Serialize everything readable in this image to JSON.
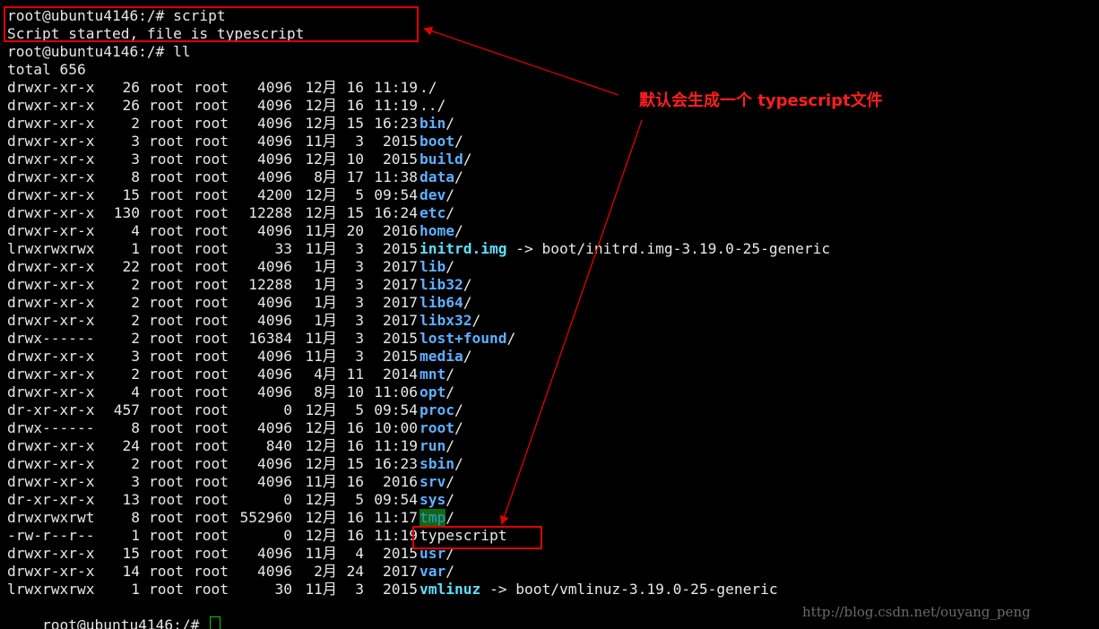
{
  "terminal": {
    "prompt_script": "root@ubuntu4146:/# script",
    "script_started": "Script started, file is typescript",
    "prompt_ll": "root@ubuntu4146:/# ll",
    "total": "total 656",
    "prompt_final": "root@ubuntu4146:/# ",
    "entries": [
      {
        "perm": "drwxr-xr-x",
        "links": "26",
        "owner": "root",
        "group": "root",
        "size": "4096",
        "month": "12月",
        "day": "16",
        "time": "11:19",
        "name": "./",
        "kind": "plain",
        "suffix": "",
        "target": ""
      },
      {
        "perm": "drwxr-xr-x",
        "links": "26",
        "owner": "root",
        "group": "root",
        "size": "4096",
        "month": "12月",
        "day": "16",
        "time": "11:19",
        "name": "../",
        "kind": "plain",
        "suffix": "",
        "target": ""
      },
      {
        "perm": "drwxr-xr-x",
        "links": "2",
        "owner": "root",
        "group": "root",
        "size": "4096",
        "month": "12月",
        "day": "15",
        "time": "16:23",
        "name": "bin",
        "kind": "dir",
        "suffix": "/",
        "target": ""
      },
      {
        "perm": "drwxr-xr-x",
        "links": "3",
        "owner": "root",
        "group": "root",
        "size": "4096",
        "month": "11月",
        "day": "3",
        "time": "2015",
        "name": "boot",
        "kind": "dir",
        "suffix": "/",
        "target": ""
      },
      {
        "perm": "drwxr-xr-x",
        "links": "3",
        "owner": "root",
        "group": "root",
        "size": "4096",
        "month": "12月",
        "day": "10",
        "time": "2015",
        "name": "build",
        "kind": "dir",
        "suffix": "/",
        "target": ""
      },
      {
        "perm": "drwxr-xr-x",
        "links": "8",
        "owner": "root",
        "group": "root",
        "size": "4096",
        "month": "8月",
        "day": "17",
        "time": "11:38",
        "name": "data",
        "kind": "dir",
        "suffix": "/",
        "target": ""
      },
      {
        "perm": "drwxr-xr-x",
        "links": "15",
        "owner": "root",
        "group": "root",
        "size": "4200",
        "month": "12月",
        "day": "5",
        "time": "09:54",
        "name": "dev",
        "kind": "dir",
        "suffix": "/",
        "target": ""
      },
      {
        "perm": "drwxr-xr-x",
        "links": "130",
        "owner": "root",
        "group": "root",
        "size": "12288",
        "month": "12月",
        "day": "15",
        "time": "16:24",
        "name": "etc",
        "kind": "dir",
        "suffix": "/",
        "target": ""
      },
      {
        "perm": "drwxr-xr-x",
        "links": "4",
        "owner": "root",
        "group": "root",
        "size": "4096",
        "month": "11月",
        "day": "20",
        "time": "2016",
        "name": "home",
        "kind": "dir",
        "suffix": "/",
        "target": ""
      },
      {
        "perm": "lrwxrwxrwx",
        "links": "1",
        "owner": "root",
        "group": "root",
        "size": "33",
        "month": "11月",
        "day": "3",
        "time": "2015",
        "name": "initrd.img",
        "kind": "link",
        "suffix": "",
        "target": " -> boot/initrd.img-3.19.0-25-generic"
      },
      {
        "perm": "drwxr-xr-x",
        "links": "22",
        "owner": "root",
        "group": "root",
        "size": "4096",
        "month": "1月",
        "day": "3",
        "time": "2017",
        "name": "lib",
        "kind": "dir",
        "suffix": "/",
        "target": ""
      },
      {
        "perm": "drwxr-xr-x",
        "links": "2",
        "owner": "root",
        "group": "root",
        "size": "12288",
        "month": "1月",
        "day": "3",
        "time": "2017",
        "name": "lib32",
        "kind": "dir",
        "suffix": "/",
        "target": ""
      },
      {
        "perm": "drwxr-xr-x",
        "links": "2",
        "owner": "root",
        "group": "root",
        "size": "4096",
        "month": "1月",
        "day": "3",
        "time": "2017",
        "name": "lib64",
        "kind": "dir",
        "suffix": "/",
        "target": ""
      },
      {
        "perm": "drwxr-xr-x",
        "links": "2",
        "owner": "root",
        "group": "root",
        "size": "4096",
        "month": "1月",
        "day": "3",
        "time": "2017",
        "name": "libx32",
        "kind": "dir",
        "suffix": "/",
        "target": ""
      },
      {
        "perm": "drwx------",
        "links": "2",
        "owner": "root",
        "group": "root",
        "size": "16384",
        "month": "11月",
        "day": "3",
        "time": "2015",
        "name": "lost+found",
        "kind": "dir",
        "suffix": "/",
        "target": ""
      },
      {
        "perm": "drwxr-xr-x",
        "links": "3",
        "owner": "root",
        "group": "root",
        "size": "4096",
        "month": "11月",
        "day": "3",
        "time": "2015",
        "name": "media",
        "kind": "dir",
        "suffix": "/",
        "target": ""
      },
      {
        "perm": "drwxr-xr-x",
        "links": "2",
        "owner": "root",
        "group": "root",
        "size": "4096",
        "month": "4月",
        "day": "11",
        "time": "2014",
        "name": "mnt",
        "kind": "dir",
        "suffix": "/",
        "target": ""
      },
      {
        "perm": "drwxr-xr-x",
        "links": "4",
        "owner": "root",
        "group": "root",
        "size": "4096",
        "month": "8月",
        "day": "10",
        "time": "11:06",
        "name": "opt",
        "kind": "dir",
        "suffix": "/",
        "target": ""
      },
      {
        "perm": "dr-xr-xr-x",
        "links": "457",
        "owner": "root",
        "group": "root",
        "size": "0",
        "month": "12月",
        "day": "5",
        "time": "09:54",
        "name": "proc",
        "kind": "dir",
        "suffix": "/",
        "target": ""
      },
      {
        "perm": "drwx------",
        "links": "8",
        "owner": "root",
        "group": "root",
        "size": "4096",
        "month": "12月",
        "day": "16",
        "time": "10:00",
        "name": "root",
        "kind": "dir",
        "suffix": "/",
        "target": ""
      },
      {
        "perm": "drwxr-xr-x",
        "links": "24",
        "owner": "root",
        "group": "root",
        "size": "840",
        "month": "12月",
        "day": "16",
        "time": "11:19",
        "name": "run",
        "kind": "dir",
        "suffix": "/",
        "target": ""
      },
      {
        "perm": "drwxr-xr-x",
        "links": "2",
        "owner": "root",
        "group": "root",
        "size": "4096",
        "month": "12月",
        "day": "15",
        "time": "16:23",
        "name": "sbin",
        "kind": "dir",
        "suffix": "/",
        "target": ""
      },
      {
        "perm": "drwxr-xr-x",
        "links": "3",
        "owner": "root",
        "group": "root",
        "size": "4096",
        "month": "11月",
        "day": "16",
        "time": "2016",
        "name": "srv",
        "kind": "dir",
        "suffix": "/",
        "target": ""
      },
      {
        "perm": "dr-xr-xr-x",
        "links": "13",
        "owner": "root",
        "group": "root",
        "size": "0",
        "month": "12月",
        "day": "5",
        "time": "09:54",
        "name": "sys",
        "kind": "dir",
        "suffix": "/",
        "target": ""
      },
      {
        "perm": "drwxrwxrwt",
        "links": "8",
        "owner": "root",
        "group": "root",
        "size": "552960",
        "month": "12月",
        "day": "16",
        "time": "11:17",
        "name": "tmp",
        "kind": "sticky",
        "suffix": "/",
        "target": ""
      },
      {
        "perm": "-rw-r--r--",
        "links": "1",
        "owner": "root",
        "group": "root",
        "size": "0",
        "month": "12月",
        "day": "16",
        "time": "11:19",
        "name": "typescript",
        "kind": "plain",
        "suffix": "",
        "target": ""
      },
      {
        "perm": "drwxr-xr-x",
        "links": "15",
        "owner": "root",
        "group": "root",
        "size": "4096",
        "month": "11月",
        "day": "4",
        "time": "2015",
        "name": "usr",
        "kind": "dir",
        "suffix": "/",
        "target": ""
      },
      {
        "perm": "drwxr-xr-x",
        "links": "14",
        "owner": "root",
        "group": "root",
        "size": "4096",
        "month": "2月",
        "day": "24",
        "time": "2017",
        "name": "var",
        "kind": "dir",
        "suffix": "/",
        "target": ""
      },
      {
        "perm": "lrwxrwxrwx",
        "links": "1",
        "owner": "root",
        "group": "root",
        "size": "30",
        "month": "11月",
        "day": "3",
        "time": "2015",
        "name": "vmlinuz",
        "kind": "link",
        "suffix": "",
        "target": " -> boot/vmlinuz-3.19.0-25-generic"
      }
    ]
  },
  "annotation": {
    "text": "默认会生成一个 typescript文件",
    "color": "#ff2020"
  },
  "watermark": "http://blog.csdn.net/ouyang_peng",
  "colors": {
    "background": "#000000",
    "text": "#e8e8e8",
    "directory": "#5fafff",
    "symlink": "#5fdfff",
    "sticky_bg": "#0d6b0d",
    "highlight_box": "#e00000",
    "cursor": "#00d000"
  }
}
